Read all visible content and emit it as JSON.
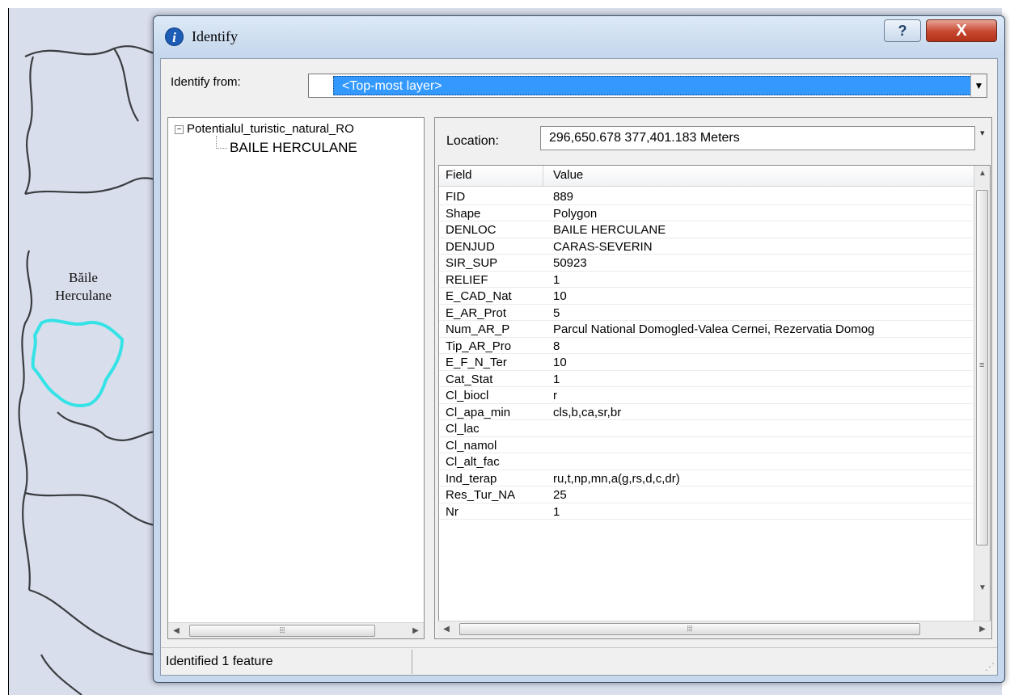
{
  "map": {
    "place_label_line1": "Băile",
    "place_label_line2": "Herculane",
    "highlight_color": "#35e3e6",
    "background_color": "#d9deec"
  },
  "dialog": {
    "title": "Identify",
    "title_icon": "info-icon",
    "help_label": "?",
    "close_label": "X"
  },
  "identify_from": {
    "label": "Identify from:",
    "selected": "<Top-most layer>"
  },
  "tree": {
    "root_label": "Potentialul_turistic_natural_RO",
    "root_expander": "−",
    "child_label": "BAILE HERCULANE"
  },
  "location": {
    "label": "Location:",
    "value": "296,650.678  377,401.183 Meters"
  },
  "grid": {
    "field_header": "Field",
    "value_header": "Value",
    "rows": [
      {
        "field": "FID",
        "value": "889"
      },
      {
        "field": "Shape",
        "value": "Polygon"
      },
      {
        "field": "DENLOC",
        "value": "BAILE HERCULANE"
      },
      {
        "field": "DENJUD",
        "value": "CARAS-SEVERIN"
      },
      {
        "field": "SIR_SUP",
        "value": "50923"
      },
      {
        "field": "RELIEF",
        "value": "1"
      },
      {
        "field": "E_CAD_Nat",
        "value": "10"
      },
      {
        "field": "E_AR_Prot",
        "value": "5"
      },
      {
        "field": "Num_AR_P",
        "value": "Parcul National Domogled-Valea Cernei, Rezervatia Domog"
      },
      {
        "field": "Tip_AR_Pro",
        "value": "8"
      },
      {
        "field": "E_F_N_Ter",
        "value": "10"
      },
      {
        "field": "Cat_Stat",
        "value": "1"
      },
      {
        "field": "Cl_biocl",
        "value": "r"
      },
      {
        "field": "Cl_apa_min",
        "value": "cls,b,ca,sr,br"
      },
      {
        "field": "Cl_lac",
        "value": ""
      },
      {
        "field": "Cl_namol",
        "value": ""
      },
      {
        "field": "Cl_alt_fac",
        "value": ""
      },
      {
        "field": "Ind_terap",
        "value": "ru,t,np,mn,a(g,rs,d,c,dr)"
      },
      {
        "field": "Res_Tur_NA",
        "value": "25"
      },
      {
        "field": "Nr",
        "value": "1"
      }
    ]
  },
  "status": {
    "text": "Identified 1 feature"
  }
}
